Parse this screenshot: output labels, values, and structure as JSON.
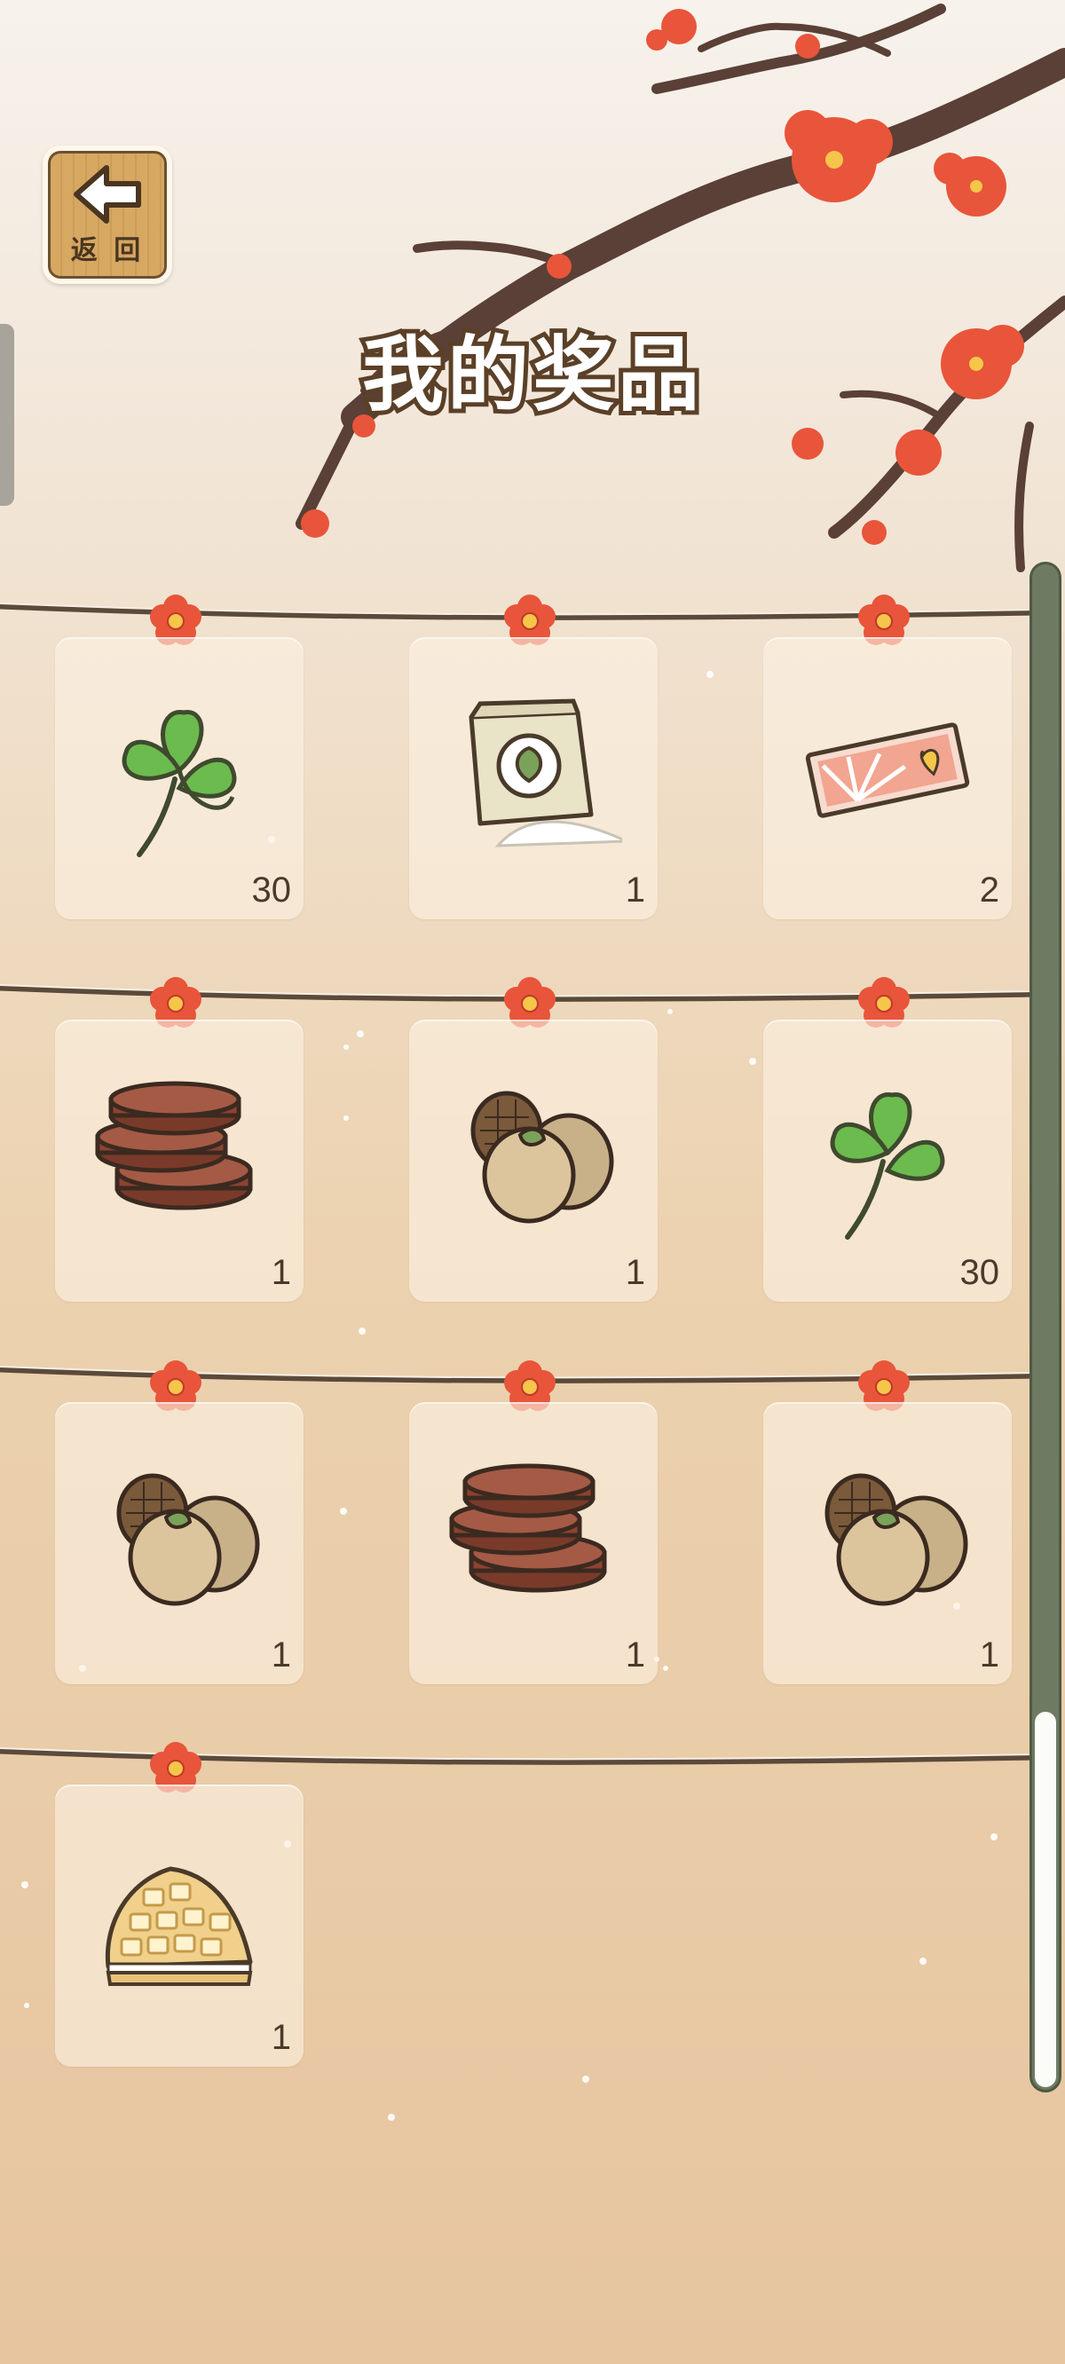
{
  "header": {
    "back_icon": "arrow-left-icon",
    "back_label": "返 回",
    "title": "我的奖品"
  },
  "prizes": [
    {
      "name": "四叶草",
      "icon": "clover-icon",
      "quantity": "30"
    },
    {
      "name": "面粉",
      "icon": "flour-bag-icon",
      "quantity": "1"
    },
    {
      "name": "票券",
      "icon": "ticket-icon",
      "quantity": "2"
    },
    {
      "name": "年轮蛋糕",
      "icon": "log-cake-icon",
      "quantity": "1"
    },
    {
      "name": "栗子",
      "icon": "chestnut-icon",
      "quantity": "1"
    },
    {
      "name": "四叶草",
      "icon": "clover-icon",
      "quantity": "30"
    },
    {
      "name": "栗子",
      "icon": "chestnut-icon",
      "quantity": "1"
    },
    {
      "name": "年轮蛋糕",
      "icon": "log-cake-icon",
      "quantity": "1"
    },
    {
      "name": "栗子",
      "icon": "chestnut-icon",
      "quantity": "1"
    },
    {
      "name": "华夫饼",
      "icon": "waffle-icon",
      "quantity": "1"
    }
  ],
  "colors": {
    "rope": "#5b4a3a",
    "flower": "#e8553a",
    "flower_center": "#f5c64a",
    "scrollbar": "#6e7a62"
  }
}
